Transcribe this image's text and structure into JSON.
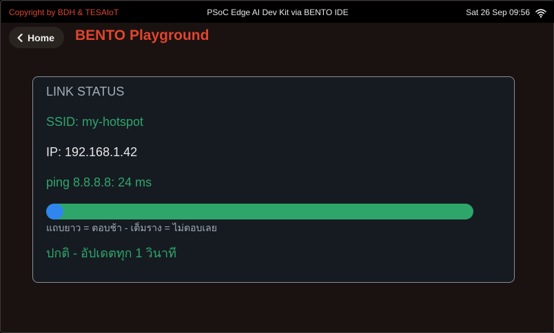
{
  "header": {
    "copyright": "Copyright by BDH & TESAIoT",
    "device": "PSoC Edge AI Dev Kit via BENTO IDE",
    "datetime": "Sat 26 Sep 09:56",
    "wifi_icon": "wifi-icon"
  },
  "nav": {
    "home_label": "Home",
    "back_icon": "chevron-left-icon",
    "title": "BENTO Playground"
  },
  "card": {
    "title": "LINK STATUS",
    "ssid": "SSID: my-hotspot",
    "ip": "IP: 192.168.1.42",
    "ping": "ping 8.8.8.8: 24 ms",
    "latency_fraction": 0.04,
    "legend": "แถบยาว = ตอบช้า - เต็มราง = ไม่ตอบเลย",
    "status": "ปกติ - อัปเดตทุก 1 วินาที"
  },
  "colors": {
    "accent_red": "#e2452e",
    "ok_green": "#2ea66a",
    "bar_blue": "#2f86ee"
  }
}
